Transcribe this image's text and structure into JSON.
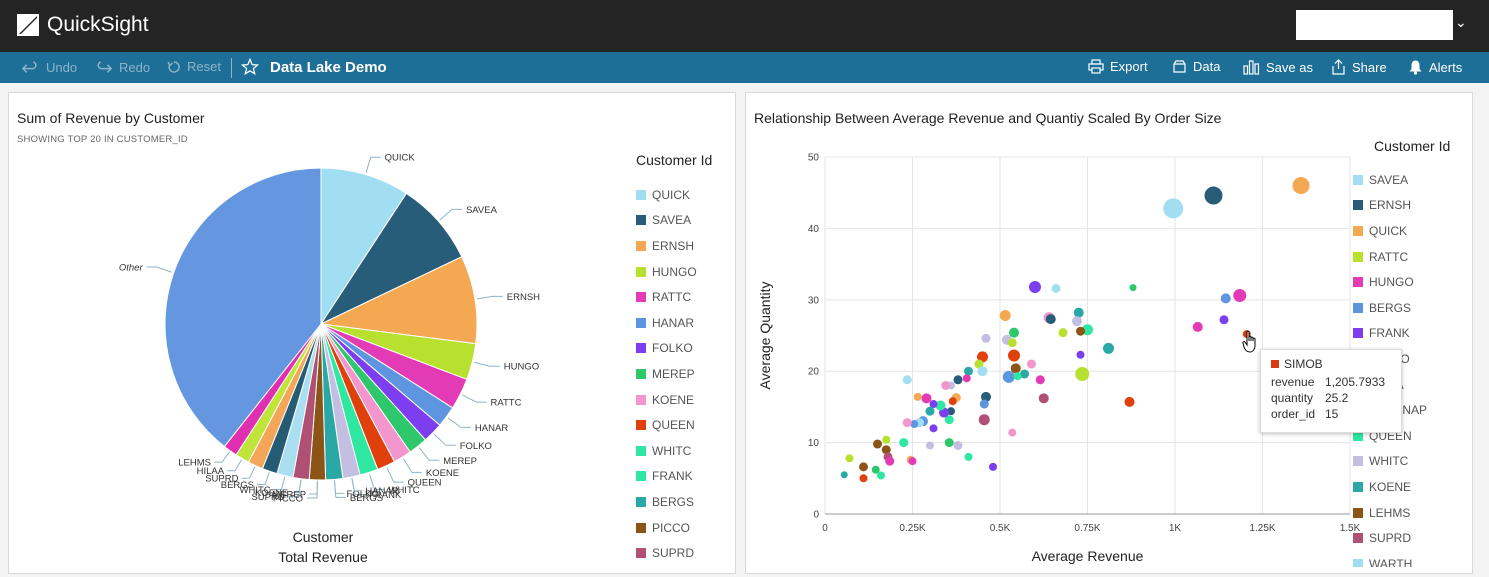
{
  "app": {
    "brand": "QuickSight"
  },
  "toolbar": {
    "undo": "Undo",
    "redo": "Redo",
    "reset": "Reset",
    "dashboard_title": "Data Lake Demo",
    "export": "Export",
    "data": "Data",
    "save_as": "Save as",
    "share": "Share",
    "alerts": "Alerts"
  },
  "pie_visual": {
    "title": "Sum of Revenue by Customer",
    "subtitle": "SHOWING TOP 20 IN CUSTOMER_ID",
    "legend_title": "Customer Id",
    "caption_group": "Customer",
    "caption_value": "Total Revenue"
  },
  "scatter_visual": {
    "title": "Relationship Between Average Revenue and Quantiy Scaled By Order Size",
    "legend_title": "Customer Id"
  },
  "tooltip": {
    "label": "SIMOB",
    "rows": [
      {
        "key": "revenue",
        "value": "1,205.7933"
      },
      {
        "key": "quantity",
        "value": "25.2"
      },
      {
        "key": "order_id",
        "value": "15"
      }
    ],
    "color": "#d93b0f"
  },
  "chart_data": [
    {
      "type": "pie",
      "title": "Sum of Revenue by Customer",
      "subtitle": "SHOWING TOP 20 IN CUSTOMER_ID",
      "group_label": "Customer",
      "value_label": "Total Revenue",
      "slices": [
        {
          "label": "QUICK",
          "value": 0.088,
          "color": "#a2def2"
        },
        {
          "label": "SAVEA",
          "value": 0.083,
          "color": "#275d78"
        },
        {
          "label": "ERNSH",
          "value": 0.087,
          "color": "#f5a852"
        },
        {
          "label": "HUNGO",
          "value": 0.036,
          "color": "#b8e02e"
        },
        {
          "label": "RATTC",
          "value": 0.031,
          "color": "#e33bb5"
        },
        {
          "label": "HANAR",
          "value": 0.021,
          "color": "#5d95e0"
        },
        {
          "label": "FOLKO",
          "value": 0.02,
          "color": "#7d3ef0"
        },
        {
          "label": "MEREP",
          "value": 0.019,
          "color": "#2ec76b"
        },
        {
          "label": "KOENE",
          "value": 0.018,
          "color": "#f296cd"
        },
        {
          "label": "QUEEN",
          "value": 0.018,
          "color": "#e0400c"
        },
        {
          "label": "WHITC",
          "value": 0.018,
          "color": "#2ee8a1"
        },
        {
          "label": "FRANK",
          "value": 0.017,
          "color": "#c2bfe0"
        },
        {
          "label": "BERGS",
          "value": 0.017,
          "color": "#2aa8a6"
        },
        {
          "label": "PICCO",
          "value": 0.016,
          "color": "#8c5416"
        },
        {
          "label": "SUPRD",
          "value": 0.016,
          "color": "#b05075"
        },
        {
          "label": "",
          "value": 0.016,
          "color": "#a9dff0"
        },
        {
          "label": "",
          "value": 0.015,
          "color": "#255c74"
        },
        {
          "label": "",
          "value": 0.015,
          "color": "#f4a658"
        },
        {
          "label": "",
          "value": 0.014,
          "color": "#c1e43b"
        },
        {
          "label": "",
          "value": 0.014,
          "color": "#e02fb1"
        },
        {
          "label": "Other",
          "value": 0.376,
          "color": "#6497e0"
        }
      ],
      "extra_slice_labels": [
        "LEHMS",
        "HILAA",
        "SUPRD",
        "BERGS",
        "WHITC",
        "KOENE",
        "MEREP",
        "FOLKO",
        "HANAR"
      ],
      "legend": [
        {
          "label": "QUICK",
          "color": "#a2def2"
        },
        {
          "label": "SAVEA",
          "color": "#275d78"
        },
        {
          "label": "ERNSH",
          "color": "#f5a852"
        },
        {
          "label": "HUNGO",
          "color": "#b8e02e"
        },
        {
          "label": "RATTC",
          "color": "#e33bb5"
        },
        {
          "label": "HANAR",
          "color": "#5d95e0"
        },
        {
          "label": "FOLKO",
          "color": "#7d3ef0"
        },
        {
          "label": "MEREP",
          "color": "#2ec76b"
        },
        {
          "label": "KOENE",
          "color": "#f296cd"
        },
        {
          "label": "QUEEN",
          "color": "#e0400c"
        },
        {
          "label": "WHITC",
          "color": "#2ee8a1"
        },
        {
          "label": "FRANK",
          "color": "#2ee8a1"
        },
        {
          "label": "BERGS",
          "color": "#2aa8a6"
        },
        {
          "label": "PICCO",
          "color": "#8c5416"
        },
        {
          "label": "SUPRD",
          "color": "#b05075"
        }
      ]
    },
    {
      "type": "scatter",
      "title": "Relationship Between Average Revenue and Quantiy Scaled By Order Size",
      "xlabel": "Average Revenue",
      "ylabel": "Average Quantity",
      "xlim": [
        0,
        1500
      ],
      "ylim": [
        0,
        50
      ],
      "x_ticks": [
        {
          "v": 0,
          "label": "0"
        },
        {
          "v": 250,
          "label": "0.25K"
        },
        {
          "v": 500,
          "label": "0.5K"
        },
        {
          "v": 750,
          "label": "0.75K"
        },
        {
          "v": 1000,
          "label": "1K"
        },
        {
          "v": 1250,
          "label": "1.25K"
        },
        {
          "v": 1500,
          "label": "1.5K"
        }
      ],
      "y_ticks": [
        {
          "v": 0,
          "label": "0"
        },
        {
          "v": 10,
          "label": "10"
        },
        {
          "v": 20,
          "label": "20"
        },
        {
          "v": 30,
          "label": "30"
        },
        {
          "v": 40,
          "label": "40"
        },
        {
          "v": 50,
          "label": "50"
        }
      ],
      "grid": true,
      "legend": [
        {
          "label": "SAVEA",
          "color": "#a2def2"
        },
        {
          "label": "ERNSH",
          "color": "#275d78"
        },
        {
          "label": "QUICK",
          "color": "#f5a852"
        },
        {
          "label": "RATTC",
          "color": "#b8e02e"
        },
        {
          "label": "HUNGO",
          "color": "#e33bb5"
        },
        {
          "label": "BERGS",
          "color": "#5d95e0"
        },
        {
          "label": "FRANK",
          "color": "#7d3ef0"
        },
        {
          "label": "FOLKO",
          "color": "#2ec76b"
        },
        {
          "label": "HILAA",
          "color": "#f296cd"
        },
        {
          "label": "SUPRNAP",
          "color": "#e0400c"
        },
        {
          "label": "QUEEN",
          "color": "#2ee8a1"
        },
        {
          "label": "WHITC",
          "color": "#c2bfe0"
        },
        {
          "label": "KOENE",
          "color": "#2aa8a6"
        },
        {
          "label": "LEHMS",
          "color": "#8c5416"
        },
        {
          "label": "SUPRD",
          "color": "#b05075"
        },
        {
          "label": "WARTH",
          "color": "#a2def2"
        }
      ],
      "points": [
        {
          "x": 995,
          "y": 42.8,
          "size": 18,
          "color": "#a2def2"
        },
        {
          "x": 1110,
          "y": 44.6,
          "size": 16,
          "color": "#275d78"
        },
        {
          "x": 1360,
          "y": 46.0,
          "size": 15,
          "color": "#f5a852"
        },
        {
          "x": 1185,
          "y": 30.6,
          "size": 11,
          "color": "#e33bb5"
        },
        {
          "x": 1145,
          "y": 30.2,
          "size": 8,
          "color": "#5d95e0"
        },
        {
          "x": 1065,
          "y": 26.2,
          "size": 8,
          "color": "#e33bb5"
        },
        {
          "x": 1140,
          "y": 27.2,
          "size": 7,
          "color": "#7d3ef0"
        },
        {
          "x": 1205,
          "y": 25.2,
          "size": 6,
          "color": "#d93b0f"
        },
        {
          "x": 880,
          "y": 31.7,
          "size": 5,
          "color": "#2ec76b"
        },
        {
          "x": 600,
          "y": 31.8,
          "size": 10,
          "color": "#7d3ef0"
        },
        {
          "x": 660,
          "y": 31.6,
          "size": 7,
          "color": "#a2def2"
        },
        {
          "x": 725,
          "y": 28.2,
          "size": 8,
          "color": "#2aa8a6"
        },
        {
          "x": 640,
          "y": 27.5,
          "size": 9,
          "color": "#f296cd"
        },
        {
          "x": 645,
          "y": 27.3,
          "size": 8,
          "color": "#275d78"
        },
        {
          "x": 720,
          "y": 27.0,
          "size": 8,
          "color": "#c2bfe0"
        },
        {
          "x": 750,
          "y": 25.8,
          "size": 9,
          "color": "#2ee8a1"
        },
        {
          "x": 730,
          "y": 25.6,
          "size": 7,
          "color": "#8c5416"
        },
        {
          "x": 680,
          "y": 25.4,
          "size": 7,
          "color": "#b8e02e"
        },
        {
          "x": 810,
          "y": 23.2,
          "size": 9,
          "color": "#2aa8a6"
        },
        {
          "x": 735,
          "y": 19.6,
          "size": 12,
          "color": "#b8e02e"
        },
        {
          "x": 730,
          "y": 22.3,
          "size": 6,
          "color": "#7d3ef0"
        },
        {
          "x": 515,
          "y": 27.8,
          "size": 9,
          "color": "#f5a852"
        },
        {
          "x": 540,
          "y": 25.4,
          "size": 8,
          "color": "#2ec76b"
        },
        {
          "x": 520,
          "y": 24.4,
          "size": 8,
          "color": "#c2bfe0"
        },
        {
          "x": 535,
          "y": 24.0,
          "size": 7,
          "color": "#b8e02e"
        },
        {
          "x": 540,
          "y": 22.2,
          "size": 10,
          "color": "#e0400c"
        },
        {
          "x": 545,
          "y": 20.4,
          "size": 8,
          "color": "#8c5416"
        },
        {
          "x": 570,
          "y": 19.6,
          "size": 7,
          "color": "#2aa8a6"
        },
        {
          "x": 590,
          "y": 21.0,
          "size": 7,
          "color": "#f296cd"
        },
        {
          "x": 525,
          "y": 19.2,
          "size": 10,
          "color": "#5d95e0"
        },
        {
          "x": 460,
          "y": 24.6,
          "size": 7,
          "color": "#c2bfe0"
        },
        {
          "x": 450,
          "y": 22.0,
          "size": 9,
          "color": "#e0400c"
        },
        {
          "x": 440,
          "y": 21.0,
          "size": 7,
          "color": "#b8e02e"
        },
        {
          "x": 450,
          "y": 20.0,
          "size": 8,
          "color": "#a2def2"
        },
        {
          "x": 410,
          "y": 20.0,
          "size": 7,
          "color": "#2aa8a6"
        },
        {
          "x": 405,
          "y": 19.0,
          "size": 6,
          "color": "#e33bb5"
        },
        {
          "x": 380,
          "y": 18.8,
          "size": 7,
          "color": "#275d78"
        },
        {
          "x": 360,
          "y": 18.0,
          "size": 6,
          "color": "#c2bfe0"
        },
        {
          "x": 375,
          "y": 16.3,
          "size": 7,
          "color": "#f5a852"
        },
        {
          "x": 365,
          "y": 15.8,
          "size": 6,
          "color": "#e0400c"
        },
        {
          "x": 360,
          "y": 14.4,
          "size": 6,
          "color": "#275d78"
        },
        {
          "x": 355,
          "y": 13.2,
          "size": 7,
          "color": "#2ee8a1"
        },
        {
          "x": 340,
          "y": 14.2,
          "size": 8,
          "color": "#7d3ef0"
        },
        {
          "x": 345,
          "y": 18.0,
          "size": 7,
          "color": "#f296cd"
        },
        {
          "x": 330,
          "y": 15.2,
          "size": 8,
          "color": "#2ee8a1"
        },
        {
          "x": 310,
          "y": 15.4,
          "size": 6,
          "color": "#7d3ef0"
        },
        {
          "x": 290,
          "y": 16.2,
          "size": 8,
          "color": "#e33bb5"
        },
        {
          "x": 265,
          "y": 16.4,
          "size": 6,
          "color": "#f5a852"
        },
        {
          "x": 300,
          "y": 14.4,
          "size": 7,
          "color": "#2aa8a6"
        },
        {
          "x": 280,
          "y": 13.0,
          "size": 8,
          "color": "#5d95e0"
        },
        {
          "x": 270,
          "y": 12.8,
          "size": 7,
          "color": "#a2def2"
        },
        {
          "x": 255,
          "y": 12.6,
          "size": 6,
          "color": "#5d95e0"
        },
        {
          "x": 235,
          "y": 12.8,
          "size": 7,
          "color": "#f296cd"
        },
        {
          "x": 235,
          "y": 18.8,
          "size": 7,
          "color": "#a2def2"
        },
        {
          "x": 225,
          "y": 10.0,
          "size": 7,
          "color": "#2ee8a1"
        },
        {
          "x": 310,
          "y": 12.0,
          "size": 6,
          "color": "#7d3ef0"
        },
        {
          "x": 355,
          "y": 10.0,
          "size": 7,
          "color": "#2ec76b"
        },
        {
          "x": 380,
          "y": 9.6,
          "size": 7,
          "color": "#c2bfe0"
        },
        {
          "x": 410,
          "y": 8.0,
          "size": 6,
          "color": "#2ee8a1"
        },
        {
          "x": 300,
          "y": 9.6,
          "size": 6,
          "color": "#c2bfe0"
        },
        {
          "x": 460,
          "y": 16.4,
          "size": 8,
          "color": "#275d78"
        },
        {
          "x": 455,
          "y": 15.4,
          "size": 7,
          "color": "#5d95e0"
        },
        {
          "x": 455,
          "y": 13.2,
          "size": 9,
          "color": "#b05075"
        },
        {
          "x": 550,
          "y": 19.3,
          "size": 6,
          "color": "#2ee8a1"
        },
        {
          "x": 615,
          "y": 18.8,
          "size": 7,
          "color": "#e33bb5"
        },
        {
          "x": 625,
          "y": 16.2,
          "size": 8,
          "color": "#b05075"
        },
        {
          "x": 870,
          "y": 15.7,
          "size": 8,
          "color": "#e0400c"
        },
        {
          "x": 535,
          "y": 11.4,
          "size": 6,
          "color": "#f296cd"
        },
        {
          "x": 480,
          "y": 6.6,
          "size": 6,
          "color": "#7d3ef0"
        },
        {
          "x": 175,
          "y": 10.4,
          "size": 6,
          "color": "#b8e02e"
        },
        {
          "x": 150,
          "y": 9.8,
          "size": 7,
          "color": "#8c5416"
        },
        {
          "x": 175,
          "y": 9.0,
          "size": 7,
          "color": "#8c5416"
        },
        {
          "x": 180,
          "y": 8.0,
          "size": 7,
          "color": "#b05075"
        },
        {
          "x": 185,
          "y": 7.4,
          "size": 7,
          "color": "#e33bb5"
        },
        {
          "x": 245,
          "y": 7.6,
          "size": 6,
          "color": "#f5a852"
        },
        {
          "x": 250,
          "y": 7.4,
          "size": 6,
          "color": "#e33bb5"
        },
        {
          "x": 70,
          "y": 7.8,
          "size": 6,
          "color": "#b8e02e"
        },
        {
          "x": 110,
          "y": 6.6,
          "size": 7,
          "color": "#8c5416"
        },
        {
          "x": 145,
          "y": 6.2,
          "size": 6,
          "color": "#2ec76b"
        },
        {
          "x": 160,
          "y": 5.4,
          "size": 6,
          "color": "#2ee8a1"
        },
        {
          "x": 55,
          "y": 5.5,
          "size": 5,
          "color": "#2aa8a6"
        },
        {
          "x": 110,
          "y": 5.0,
          "size": 6,
          "color": "#e0400c"
        }
      ]
    }
  ]
}
